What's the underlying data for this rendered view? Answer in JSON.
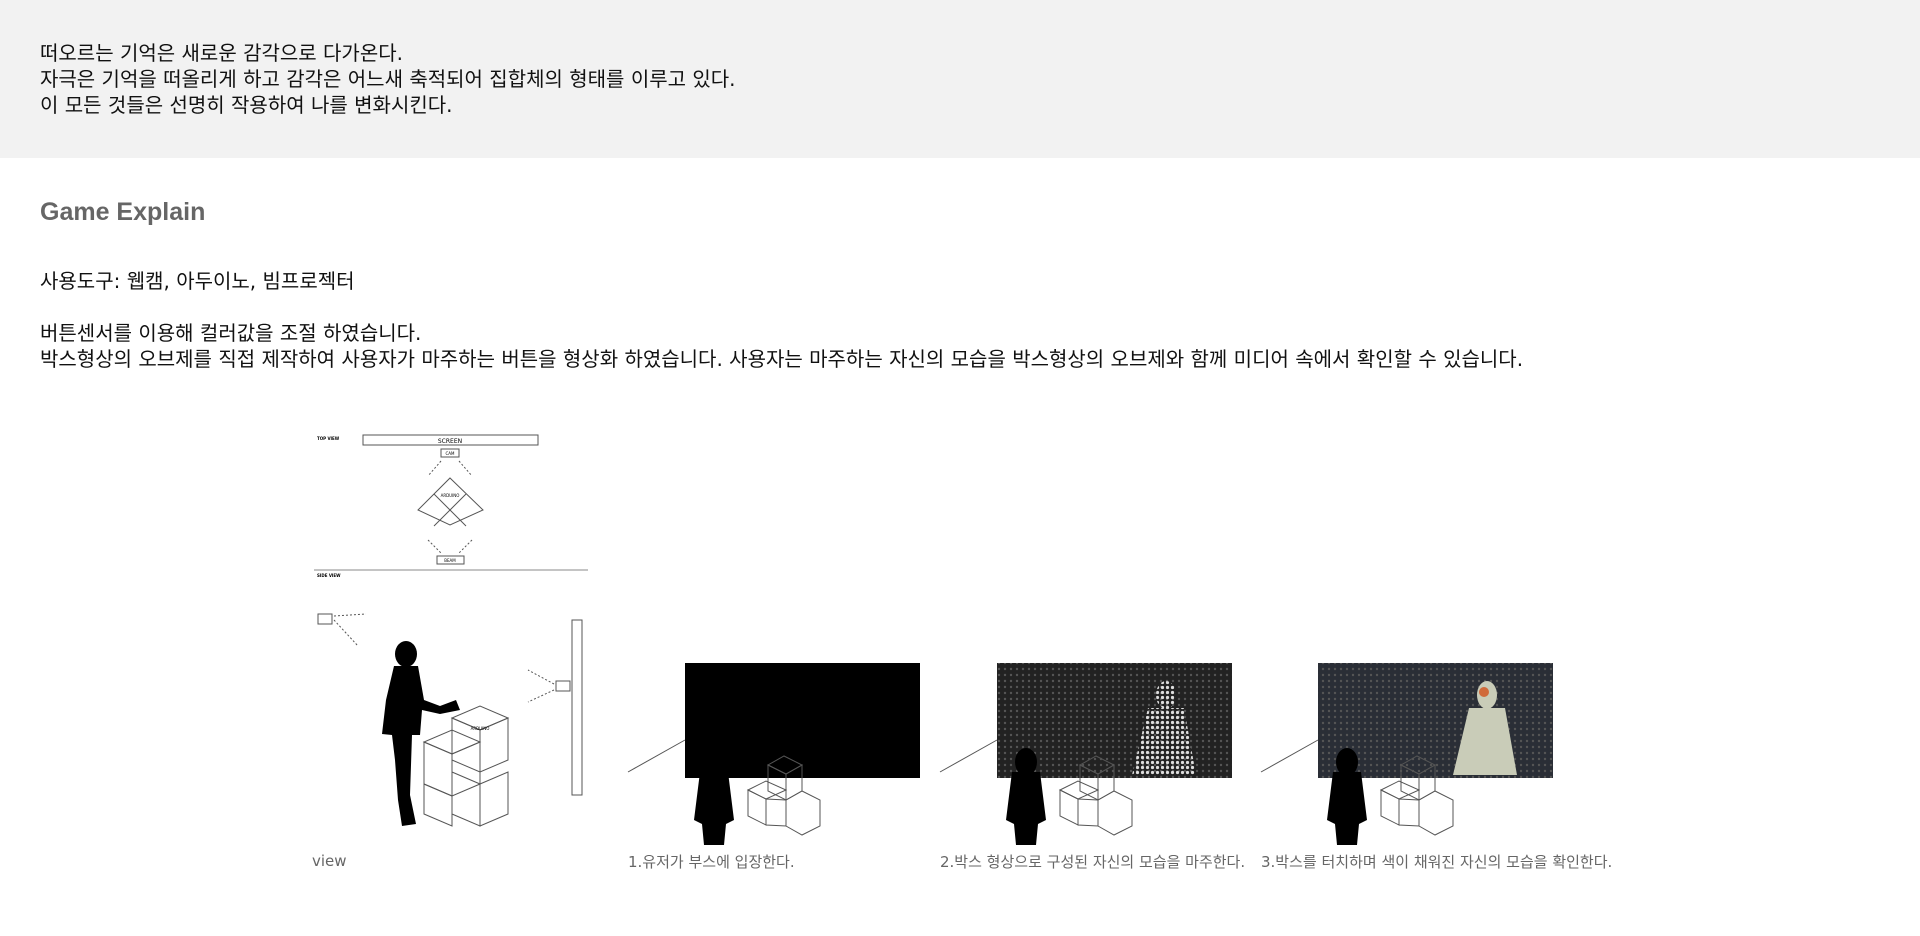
{
  "intro": {
    "lines": [
      "떠오르는 기억은 새로운 감각으로 다가온다.",
      "자극은 기억을 떠올리게 하고 감각은 어느새 축적되어 집합체의 형태를 이루고 있다.",
      "이 모든 것들은 선명히 작용하여 나를 변화시킨다."
    ]
  },
  "section": {
    "title": "Game Explain"
  },
  "tools": "사용도구: 웹캠, 아두이노, 빔프로젝터",
  "description": {
    "lines": [
      "버튼센서를 이용해 컬러값을 조절 하였습니다.",
      "박스형상의 오브제를 직접 제작하여 사용자가 마주하는 버튼을 형상화 하였습니다. 사용자는 마주하는 자신의 모습을 박스형상의 오브제와 함께 미디어 속에서 확인할 수 있습니다."
    ]
  },
  "diagram": {
    "top_view_label": "TOP VIEW",
    "side_view_label": "SIDE VIEW",
    "screen_label": "SCREEN",
    "cam_label": "CAM",
    "arduino_label": "ARDUINO",
    "beam_label": "BEAM",
    "caption": "view"
  },
  "steps": [
    {
      "caption": "1.유저가 부스에 입장한다."
    },
    {
      "caption": "2.박스 형상으로 구성된 자신의 모습을 마주한다."
    },
    {
      "caption": "3.박스를 터치하며 색이 채워진 자신의 모습을 확인한다."
    }
  ]
}
